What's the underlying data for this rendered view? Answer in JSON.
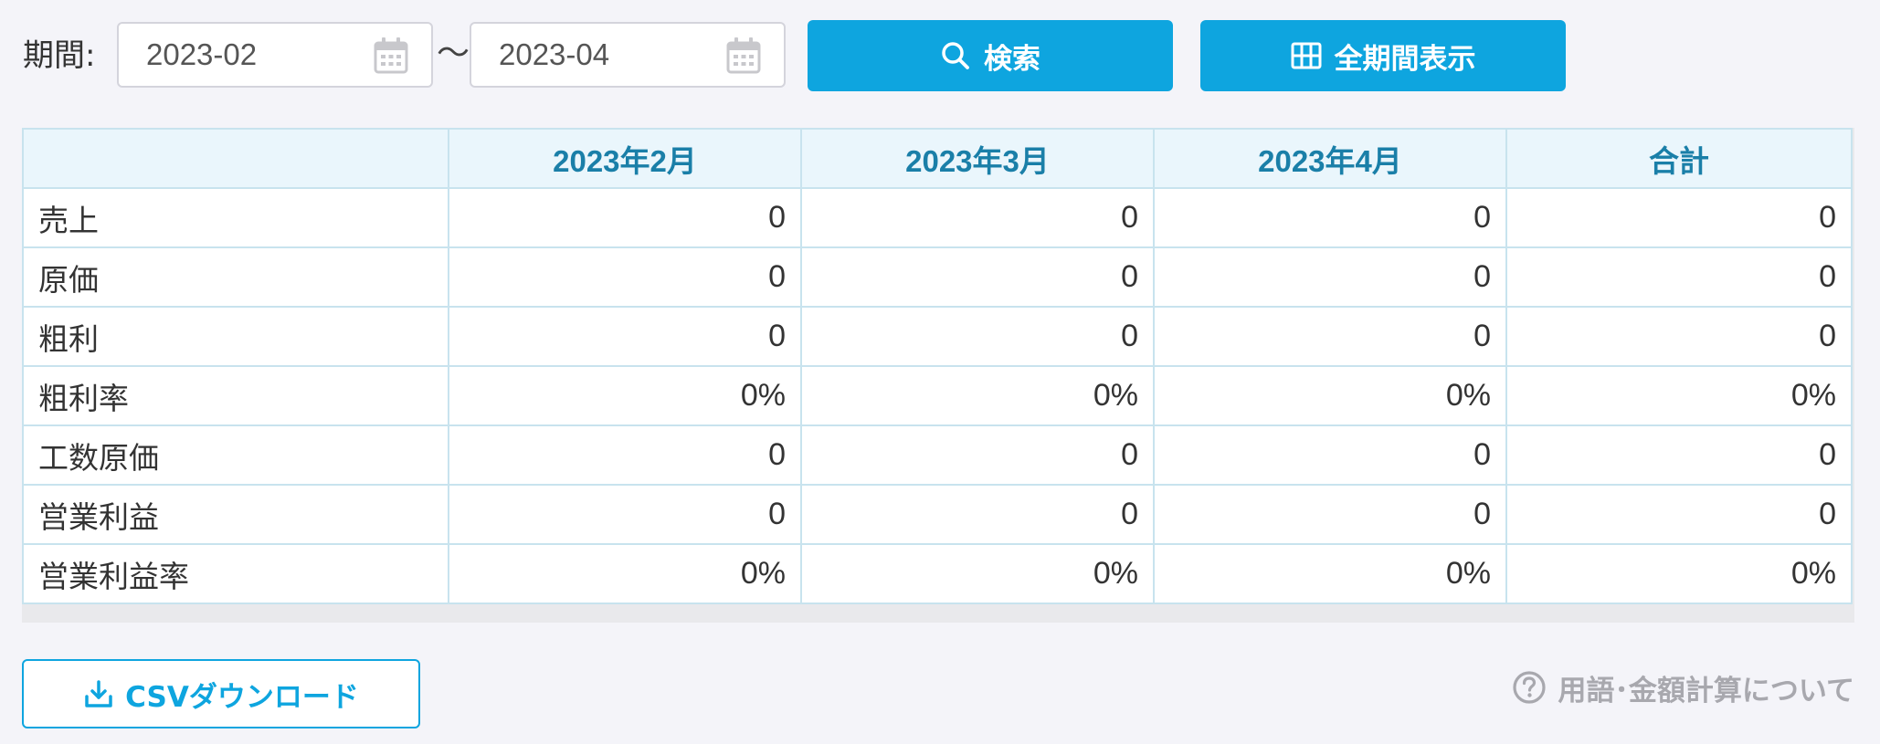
{
  "filter": {
    "period_label": "期間:",
    "from_value": "2023-02",
    "to_value": "2023-04",
    "range_separator": "〜",
    "search_label": "検索",
    "all_period_label": "全期間表示"
  },
  "table": {
    "columns": [
      "",
      "2023年2月",
      "2023年3月",
      "2023年4月",
      "合計"
    ],
    "rows": [
      {
        "label": "売上",
        "values": [
          "0",
          "0",
          "0",
          "0"
        ]
      },
      {
        "label": "原価",
        "values": [
          "0",
          "0",
          "0",
          "0"
        ]
      },
      {
        "label": "粗利",
        "values": [
          "0",
          "0",
          "0",
          "0"
        ]
      },
      {
        "label": "粗利率",
        "values": [
          "0%",
          "0%",
          "0%",
          "0%"
        ]
      },
      {
        "label": "工数原価",
        "values": [
          "0",
          "0",
          "0",
          "0"
        ]
      },
      {
        "label": "営業利益",
        "values": [
          "0",
          "0",
          "0",
          "0"
        ]
      },
      {
        "label": "営業利益率",
        "values": [
          "0%",
          "0%",
          "0%",
          "0%"
        ]
      }
    ]
  },
  "footer": {
    "csv_label": "CSVダウンロード",
    "help_label": "用語･金額計算について"
  },
  "colors": {
    "accent": "#0ea5df",
    "header_bg": "#eaf6fc",
    "header_text": "#1a7fa8",
    "border": "#c8e3ee"
  },
  "icons": {
    "calendar": "calendar-icon",
    "search": "search-icon",
    "grid": "grid-icon",
    "download": "download-icon",
    "help": "question-circle-icon"
  }
}
